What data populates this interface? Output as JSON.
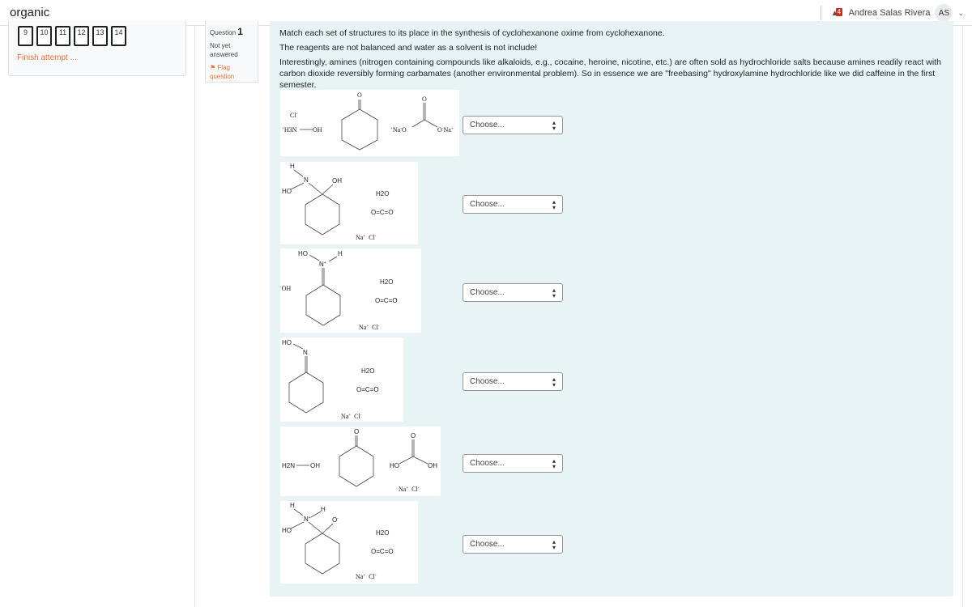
{
  "header": {
    "brand": "organic",
    "notification_count": "4",
    "user_name": "Andrea Salas Rivera",
    "user_initials": "AS"
  },
  "quiz_nav": {
    "question_buttons": [
      "9",
      "10",
      "11",
      "12",
      "13",
      "14"
    ],
    "finish_label": "Finish attempt ..."
  },
  "question_info": {
    "label": "Question",
    "number": "1",
    "state": "Not yet answered",
    "flag_label": "Flag question"
  },
  "question": {
    "paragraphs": [
      "Match each set of structures to its place in the synthesis of cyclohexanone oxime from cyclohexanone.",
      "The reagents are not balanced and water as a solvent is not include!",
      "Interestingly, amines (nitrogen containing compounds like alkaloids, e.g., cocaine, heroine, nicotine, etc.) are often sold as hydrochloride salts because amines readily react with carbon dioxide reversibly forming carbamates (another environmental problem).  So in essence we are \"freebasing\" hydroxylamine hydrochloride like we did caffeine in the first semester."
    ]
  },
  "items": [
    {
      "name": "hydroxylamine hydrochloride + cyclohexanone + sodium carbonate",
      "labels": {
        "cl": "Cl",
        "h3n": "H3N",
        "oh": "OH",
        "o_top": "O",
        "na_left": "Na",
        "o_left": "O",
        "o_right": "O",
        "na_right": "Na",
        "carbonyl_o": "O"
      },
      "select_value": "Choose..."
    },
    {
      "name": "carbinolamine intermediate + H2O + CO2 + NaCl",
      "labels": {
        "h": "H",
        "n": "N",
        "ho": "HO",
        "oh": "OH",
        "h2o": "H2O",
        "co2": "O=C=O",
        "na": "Na",
        "cl": "Cl"
      },
      "select_value": "Choose..."
    },
    {
      "name": "protonated oxime + hydroxide + H2O + CO2 + NaCl",
      "labels": {
        "ho": "HO",
        "n": "N",
        "h": "H",
        "oh": "OH",
        "h2o": "H2O",
        "co2": "O=C=O",
        "na": "Na",
        "cl": "Cl"
      },
      "select_value": "Choose..."
    },
    {
      "name": "cyclohexanone oxime + H2O + CO2 + NaCl",
      "labels": {
        "ho": "HO",
        "n": "N",
        "h2o": "H2O",
        "co2": "O=C=O",
        "na": "Na",
        "cl": "Cl"
      },
      "select_value": "Choose..."
    },
    {
      "name": "hydroxylamine + cyclohexanone + carbonic acid + NaCl",
      "labels": {
        "h2n": "H2N",
        "oh": "OH",
        "o": "O",
        "ho_left": "HO",
        "oh_right": "OH",
        "na": "Na",
        "cl": "Cl"
      },
      "select_value": "Choose..."
    },
    {
      "name": "zwitterionic tetrahedral intermediate + H2O + CO2 + NaCl",
      "labels": {
        "h1": "H",
        "h2": "H",
        "n": "N",
        "ho": "HO",
        "o": "O",
        "h2o": "H2O",
        "co2": "O=C=O",
        "na": "Na",
        "cl": "Cl"
      },
      "select_value": "Choose..."
    }
  ],
  "select_placeholder": "Choose..."
}
